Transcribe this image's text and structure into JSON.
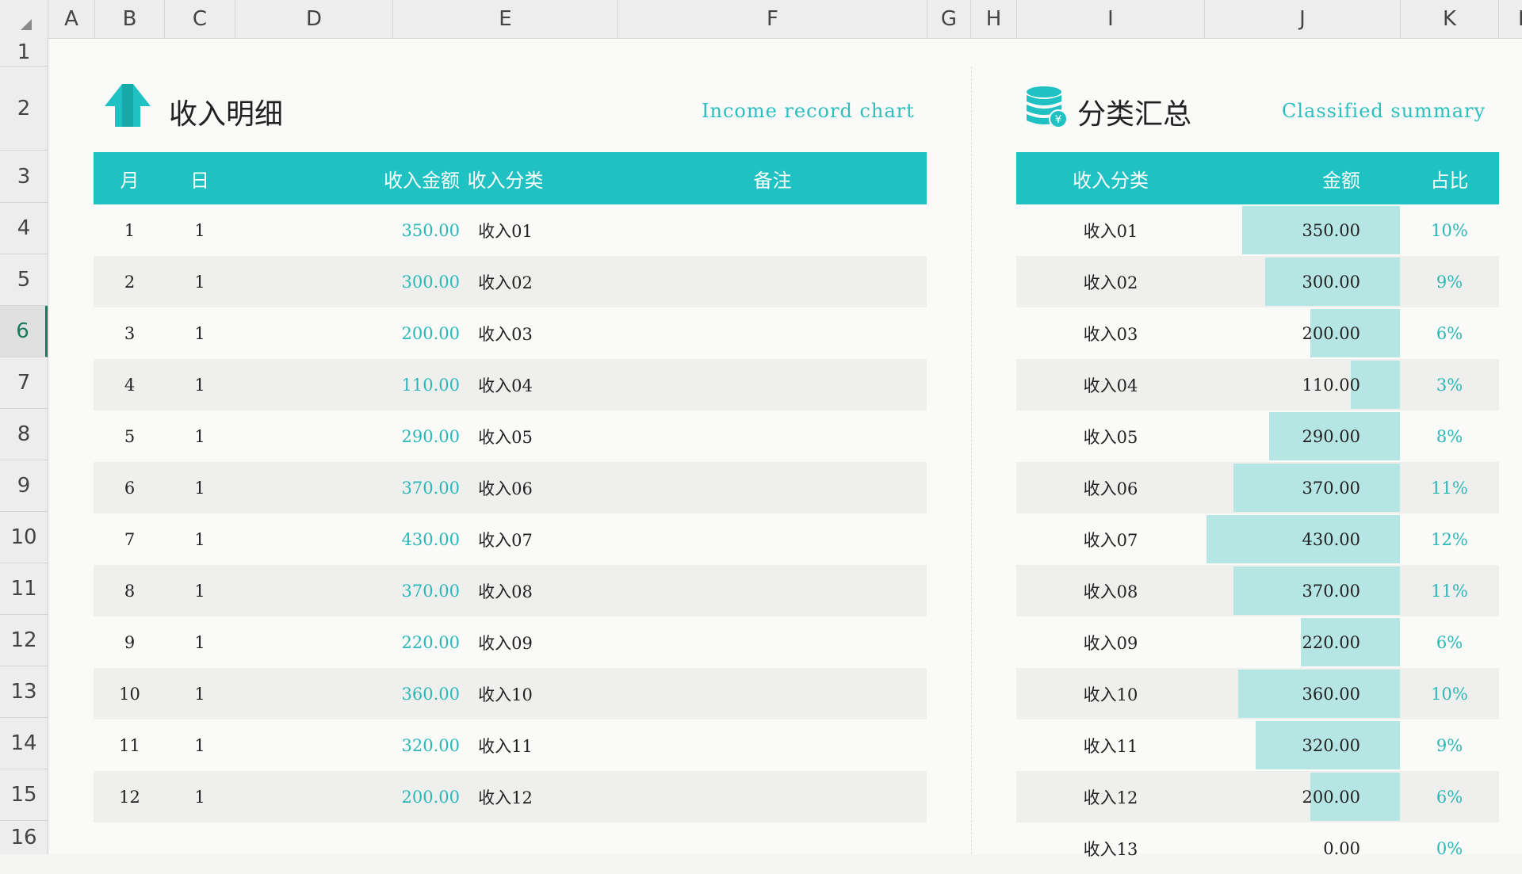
{
  "column_headers": [
    "A",
    "B",
    "C",
    "D",
    "E",
    "F",
    "G",
    "H",
    "I",
    "J",
    "K",
    "L"
  ],
  "row_headers": [
    "1",
    "2",
    "3",
    "4",
    "5",
    "6",
    "7",
    "8",
    "9",
    "10",
    "11",
    "12",
    "13",
    "14",
    "15",
    "16"
  ],
  "active_row": "6",
  "left_panel": {
    "title": "收入明细",
    "subtitle": "Income record chart",
    "headers": [
      "月",
      "日",
      "收入金额",
      "收入分类",
      "备注"
    ],
    "rows": [
      {
        "month": "1",
        "day": "1",
        "amount": "350.00",
        "category": "收入01",
        "note": ""
      },
      {
        "month": "2",
        "day": "1",
        "amount": "300.00",
        "category": "收入02",
        "note": ""
      },
      {
        "month": "3",
        "day": "1",
        "amount": "200.00",
        "category": "收入03",
        "note": ""
      },
      {
        "month": "4",
        "day": "1",
        "amount": "110.00",
        "category": "收入04",
        "note": ""
      },
      {
        "month": "5",
        "day": "1",
        "amount": "290.00",
        "category": "收入05",
        "note": ""
      },
      {
        "month": "6",
        "day": "1",
        "amount": "370.00",
        "category": "收入06",
        "note": ""
      },
      {
        "month": "7",
        "day": "1",
        "amount": "430.00",
        "category": "收入07",
        "note": ""
      },
      {
        "month": "8",
        "day": "1",
        "amount": "370.00",
        "category": "收入08",
        "note": ""
      },
      {
        "month": "9",
        "day": "1",
        "amount": "220.00",
        "category": "收入09",
        "note": ""
      },
      {
        "month": "10",
        "day": "1",
        "amount": "360.00",
        "category": "收入10",
        "note": ""
      },
      {
        "month": "11",
        "day": "1",
        "amount": "320.00",
        "category": "收入11",
        "note": ""
      },
      {
        "month": "12",
        "day": "1",
        "amount": "200.00",
        "category": "收入12",
        "note": ""
      }
    ]
  },
  "right_panel": {
    "title": "分类汇总",
    "subtitle": "Classified summary",
    "headers": [
      "收入分类",
      "金额",
      "占比"
    ],
    "rows": [
      {
        "category": "收入01",
        "amount": "350.00",
        "value": 350,
        "percent": "10%"
      },
      {
        "category": "收入02",
        "amount": "300.00",
        "value": 300,
        "percent": "9%"
      },
      {
        "category": "收入03",
        "amount": "200.00",
        "value": 200,
        "percent": "6%"
      },
      {
        "category": "收入04",
        "amount": "110.00",
        "value": 110,
        "percent": "3%"
      },
      {
        "category": "收入05",
        "amount": "290.00",
        "value": 290,
        "percent": "8%"
      },
      {
        "category": "收入06",
        "amount": "370.00",
        "value": 370,
        "percent": "11%"
      },
      {
        "category": "收入07",
        "amount": "430.00",
        "value": 430,
        "percent": "12%"
      },
      {
        "category": "收入08",
        "amount": "370.00",
        "value": 370,
        "percent": "11%"
      },
      {
        "category": "收入09",
        "amount": "220.00",
        "value": 220,
        "percent": "6%"
      },
      {
        "category": "收入10",
        "amount": "360.00",
        "value": 360,
        "percent": "10%"
      },
      {
        "category": "收入11",
        "amount": "320.00",
        "value": 320,
        "percent": "9%"
      },
      {
        "category": "收入12",
        "amount": "200.00",
        "value": 200,
        "percent": "6%"
      },
      {
        "category": "收入13",
        "amount": "0.00",
        "value": 0,
        "percent": "0%"
      }
    ]
  },
  "icons": {
    "income_icon": "upload-arrows-icon",
    "summary_icon": "coin-stack-icon"
  },
  "colors": {
    "accent": "#1fc1c3",
    "accent_text": "#2bb8b8",
    "bar_fill": "#b6e6e4",
    "row_alt": "#efefed"
  }
}
